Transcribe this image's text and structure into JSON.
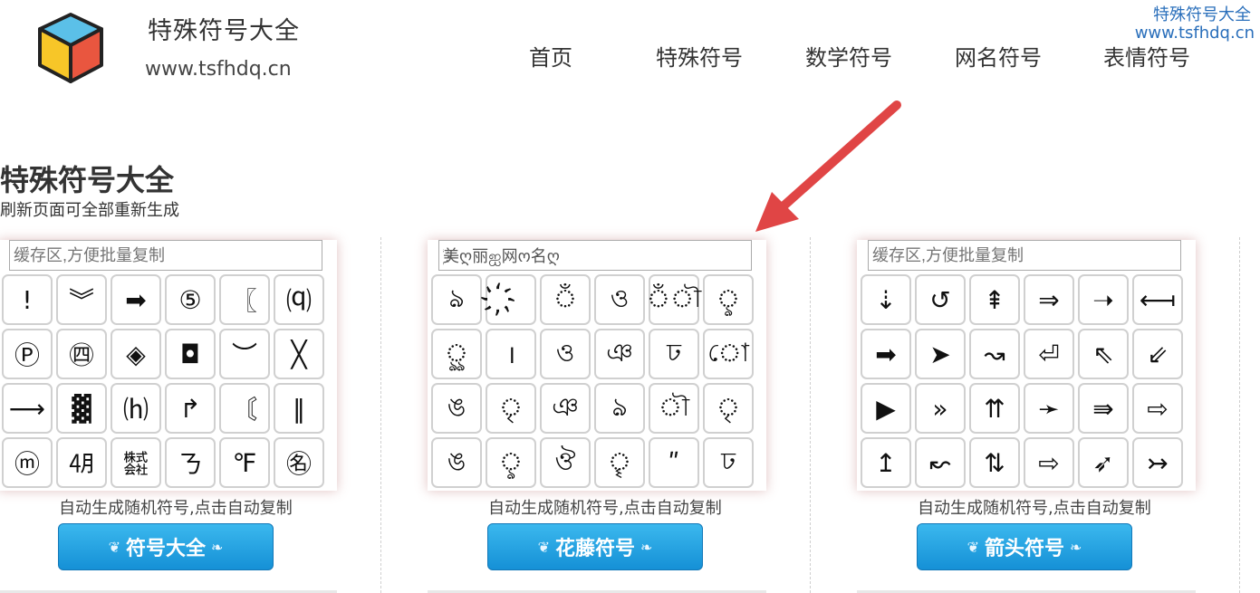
{
  "header": {
    "site_name": "特殊符号大全",
    "site_url": "www.tsfhdq.cn",
    "nav": [
      "首页",
      "特殊符号",
      "数学符号",
      "网名符号",
      "表情符号"
    ]
  },
  "watermark": {
    "line1": "特殊符号大全",
    "line2": "www.tsfhdq.cn"
  },
  "page": {
    "title": "特殊符号大全",
    "subtitle": "刷新页面可全部重新生成"
  },
  "panels": [
    {
      "buffer_placeholder": "缓存区,方便批量复制",
      "buffer_value": "",
      "symbols": [
        "!",
        "︾",
        "➡",
        "⑤",
        "〖",
        "⒬",
        "Ⓟ",
        "㊃",
        "◈",
        "◘",
        "︶",
        "╳",
        "⟶",
        "▓",
        "⒣",
        "↱",
        "〘",
        "‖",
        "ⓜ",
        "㋃",
        "㍿",
        "ㄋ",
        "℉",
        "㊔"
      ],
      "hint": "自动生成随机符号,点击自动复制",
      "button": "符号大全"
    },
    {
      "buffer_placeholder": "",
      "buffer_value": "҉美ღ丽ஐ网ო名ღ",
      "symbols": [
        "ঌ",
        "҉",
        "ঁ",
        "ও",
        "ঁৗ",
        "ৢ",
        "ৣ",
        "।",
        "ও",
        "ঞ",
        "ঢ",
        "ো",
        "ঙ",
        "ৃ",
        "ঞ",
        "ঌ",
        "ৗ",
        "ৃ",
        "ঙ",
        "ৢ",
        "ঔ",
        "ৄ",
        "ʺ",
        "ঢ"
      ],
      "hint": "自动生成随机符号,点击自动复制",
      "button": "花藤符号"
    },
    {
      "buffer_placeholder": "缓存区,方便批量复制",
      "buffer_value": "",
      "symbols": [
        "⇣",
        "↺",
        "⇞",
        "⇒",
        "➝",
        "⟻",
        "➡",
        "➤",
        "↝",
        "⏎",
        "⇖",
        "⇙",
        "▶",
        "»",
        "⇈",
        "➛",
        "⇛",
        "⇨",
        "↥",
        "↜",
        "⇅",
        "⇨",
        "➶",
        "↣"
      ],
      "hint": "自动生成随机符号,点击自动复制",
      "button": "箭头符号"
    }
  ],
  "colors": {
    "button_top": "#3bb8ee",
    "button_bottom": "#1590d6",
    "arrow": "#e04545",
    "watermark": "#2a6fbb"
  }
}
